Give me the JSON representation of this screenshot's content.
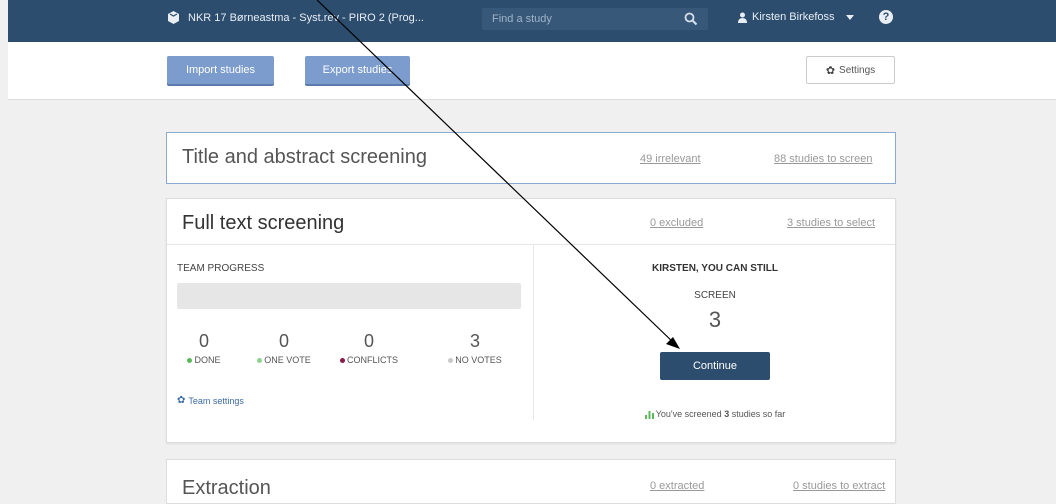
{
  "header": {
    "project_title": "NKR 17 Børneastma - Syst.rev - PIRO 2 (Prog...",
    "search_placeholder": "Find a study",
    "user_name": "Kirsten Birkefoss"
  },
  "toolbar": {
    "import_label": "Import studies",
    "export_label": "Export studies",
    "settings_label": "Settings"
  },
  "title_abstract": {
    "title": "Title and abstract screening",
    "irrelevant_link": "49 irrelevant",
    "to_screen_link": "88 studies to screen"
  },
  "full_text": {
    "title": "Full text screening",
    "excluded_link": "0 excluded",
    "to_select_link": "3 studies to select",
    "team_progress_label": "TEAM PROGRESS",
    "stats": [
      {
        "value": "0",
        "label": "DONE",
        "color": "#5cb85c"
      },
      {
        "value": "0",
        "label": "ONE VOTE",
        "color": "#8fd18f"
      },
      {
        "value": "0",
        "label": "CONFLICTS",
        "color": "#8b1a4a"
      },
      {
        "value": "3",
        "label": "NO VOTES",
        "color": "#c8c8c8"
      }
    ],
    "team_settings_label": "Team settings",
    "you_can_still": "KIRSTEN, YOU CAN STILL",
    "screen_label": "SCREEN",
    "screen_count": "3",
    "continue_label": "Continue",
    "screened_prefix": "You've screened",
    "screened_count": "3",
    "screened_suffix": "studies so far"
  },
  "extraction": {
    "title": "Extraction",
    "extracted_link": "0 extracted",
    "to_extract_link": "0 studies to extract"
  },
  "colors": {
    "navbar": "#2d4d6e",
    "primary_button": "#7b9ccc",
    "continue_button": "#2d4d6e",
    "link_blue": "#3d6aa6",
    "bar_icon_green": "#5cb85c"
  }
}
